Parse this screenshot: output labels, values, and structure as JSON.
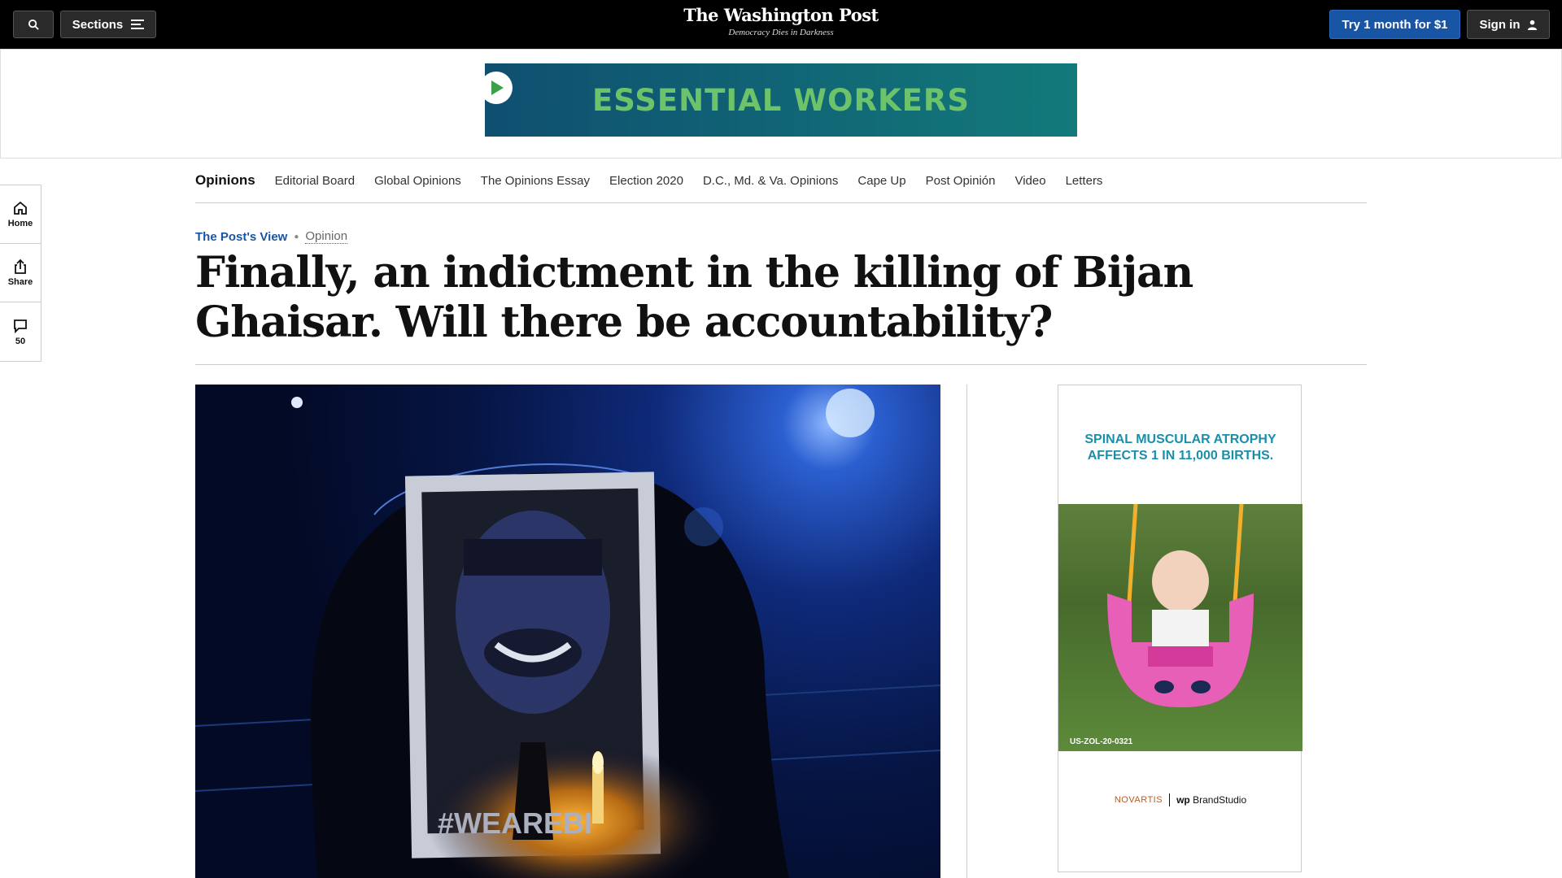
{
  "header": {
    "sections_label": "Sections",
    "logo": "The Washington Post",
    "tagline": "Democracy Dies in Darkness",
    "try_label": "Try 1 month for $1",
    "signin_label": "Sign in"
  },
  "top_ad": {
    "text": "ESSENTIAL WORKERS"
  },
  "subnav": {
    "brand": "Opinions",
    "items": [
      "Editorial Board",
      "Global Opinions",
      "The Opinions Essay",
      "Election 2020",
      "D.C., Md. & Va. Opinions",
      "Cape Up",
      "Post Opinión",
      "Video",
      "Letters"
    ]
  },
  "rail": {
    "home_label": "Home",
    "share_label": "Share",
    "comments_count": "50"
  },
  "article": {
    "kicker_label": "The Post's View",
    "kicker_section": "Opinion",
    "headline": "Finally, an indictment in the killing of Bijan Ghaisar. Will there be accountability?",
    "photo_shirt_text": "#WEAREBI"
  },
  "side_ad": {
    "headline": "SPINAL MUSCULAR ATROPHY AFFECTS 1 IN 11,000 BIRTHS.",
    "code": "US-ZOL-20-0321",
    "sponsor": "NOVARTIS",
    "studio": "BrandStudio"
  },
  "colors": {
    "accent_blue": "#1955a5",
    "ad_green": "#6cc36a",
    "ad_teal": "#1a8fa9"
  }
}
